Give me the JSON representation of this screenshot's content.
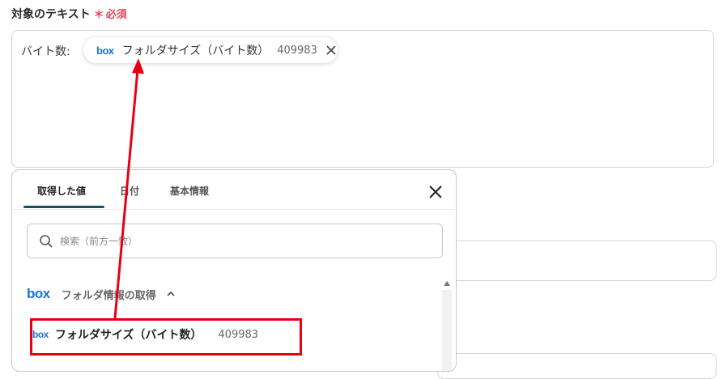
{
  "field": {
    "label": "対象のテキスト",
    "required_mark": "＊",
    "required_text": "必須",
    "prefix": "バイト数:",
    "chip": {
      "logo": "box",
      "label": "フォルダサイズ（バイト数）",
      "value": "409983",
      "close_icon": "close-icon"
    }
  },
  "popup": {
    "tabs": [
      {
        "label": "取得した値",
        "active": true
      },
      {
        "label": "日付",
        "active": false
      },
      {
        "label": "基本情報",
        "active": false
      }
    ],
    "close_icon": "close-icon",
    "search": {
      "icon": "search-icon",
      "placeholder": "検索（前方一致）"
    },
    "group": {
      "logo": "box",
      "label": "フォルダ情報の取得",
      "icon": "chevron-up-icon"
    },
    "options": [
      {
        "logo": "box",
        "label": "フォルダサイズ（バイト数）",
        "value": "409983"
      }
    ]
  },
  "colors": {
    "required": "#e8455a",
    "box_brand": "#1a73d9",
    "tab_underline": "#1f4e5f",
    "annotation": "#e60012"
  }
}
